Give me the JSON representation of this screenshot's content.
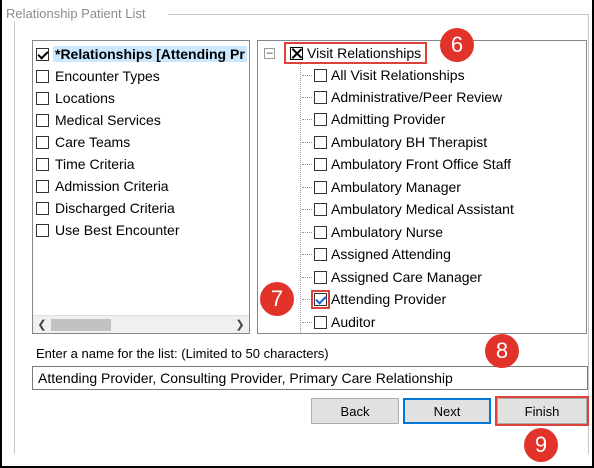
{
  "dialog": {
    "group_title": "Relationship Patient List"
  },
  "left_list": {
    "items": [
      {
        "label": "*Relationships [Attending Pr",
        "checked": true,
        "selected": true
      },
      {
        "label": "Encounter Types",
        "checked": false
      },
      {
        "label": "Locations",
        "checked": false
      },
      {
        "label": "Medical Services",
        "checked": false
      },
      {
        "label": "Care Teams",
        "checked": false
      },
      {
        "label": "Time Criteria",
        "checked": false
      },
      {
        "label": "Admission Criteria",
        "checked": false
      },
      {
        "label": "Discharged Criteria",
        "checked": false
      },
      {
        "label": "Use Best Encounter",
        "checked": false
      }
    ]
  },
  "tree": {
    "root_label": "Visit Relationships",
    "items": [
      {
        "label": "All Visit Relationships",
        "checked": false
      },
      {
        "label": "Administrative/Peer Review",
        "checked": false
      },
      {
        "label": "Admitting Provider",
        "checked": false
      },
      {
        "label": "Ambulatory BH Therapist",
        "checked": false
      },
      {
        "label": "Ambulatory Front Office Staff",
        "checked": false
      },
      {
        "label": "Ambulatory Manager",
        "checked": false
      },
      {
        "label": "Ambulatory Medical Assistant",
        "checked": false
      },
      {
        "label": "Ambulatory Nurse",
        "checked": false
      },
      {
        "label": "Assigned Attending",
        "checked": false
      },
      {
        "label": "Assigned Care Manager",
        "checked": false
      },
      {
        "label": "Attending Provider",
        "checked": true
      },
      {
        "label": "Auditor",
        "checked": false
      }
    ]
  },
  "name_field": {
    "label": "Enter a name for the list: (Limited to 50 characters)",
    "value": "Attending Provider, Consulting Provider, Primary Care Relationship"
  },
  "buttons": {
    "back": "Back",
    "next": "Next",
    "finish": "Finish"
  },
  "badges": {
    "b6": "6",
    "b7": "7",
    "b8": "8",
    "b9": "9"
  },
  "colors": {
    "highlight": "#e0403a",
    "badge": "#e2332b",
    "selection": "#cce8ff"
  }
}
